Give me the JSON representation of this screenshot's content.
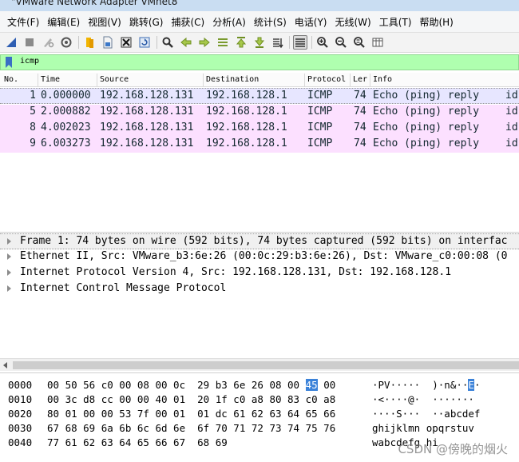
{
  "window": {
    "title": "\"VMware Network Adapter VMnet8"
  },
  "menu": [
    "文件(F)",
    "编辑(E)",
    "视图(V)",
    "跳转(G)",
    "捕获(C)",
    "分析(A)",
    "统计(S)",
    "电话(Y)",
    "无线(W)",
    "工具(T)",
    "帮助(H)"
  ],
  "filter": {
    "value": "icmp"
  },
  "packet_list": {
    "columns": [
      "No.",
      "Time",
      "Source",
      "Destination",
      "Protocol",
      "Ler",
      "Info"
    ],
    "rows": [
      {
        "no": "1",
        "time": "0.000000",
        "source": "192.168.128.131",
        "destination": "192.168.128.1",
        "protocol": "ICMP",
        "length": "74",
        "info": "Echo (ping) reply",
        "extra": "id"
      },
      {
        "no": "5",
        "time": "2.000882",
        "source": "192.168.128.131",
        "destination": "192.168.128.1",
        "protocol": "ICMP",
        "length": "74",
        "info": "Echo (ping) reply",
        "extra": "id"
      },
      {
        "no": "8",
        "time": "4.002023",
        "source": "192.168.128.131",
        "destination": "192.168.128.1",
        "protocol": "ICMP",
        "length": "74",
        "info": "Echo (ping) reply",
        "extra": "id"
      },
      {
        "no": "9",
        "time": "6.003273",
        "source": "192.168.128.131",
        "destination": "192.168.128.1",
        "protocol": "ICMP",
        "length": "74",
        "info": "Echo (ping) reply",
        "extra": "id"
      }
    ]
  },
  "details": [
    "Frame 1: 74 bytes on wire (592 bits), 74 bytes captured (592 bits) on interfac",
    "Ethernet II, Src: VMware_b3:6e:26 (00:0c:29:b3:6e:26), Dst: VMware_c0:00:08 (0",
    "Internet Protocol Version 4, Src: 192.168.128.131, Dst: 192.168.128.1",
    "Internet Control Message Protocol"
  ],
  "bytes": [
    {
      "offset": "0000",
      "hex_a": "00 50 56 c0 00 08 00 0c  29 b3 6e 26 08 00 ",
      "hex_sel": "45",
      "hex_b": " 00",
      "ascii_a": "·PV·····  )·n&··",
      "ascii_sel": "E",
      "ascii_b": "·"
    },
    {
      "offset": "0010",
      "hex_a": "00 3c d8 cc 00 00 40 01  20 1f c0 a8 80 83 c0 a8",
      "hex_sel": "",
      "hex_b": "",
      "ascii_a": "·<····@·  ·······",
      "ascii_sel": "",
      "ascii_b": ""
    },
    {
      "offset": "0020",
      "hex_a": "80 01 00 00 53 7f 00 01  01 dc 61 62 63 64 65 66",
      "hex_sel": "",
      "hex_b": "",
      "ascii_a": "····S···  ··abcdef",
      "ascii_sel": "",
      "ascii_b": ""
    },
    {
      "offset": "0030",
      "hex_a": "67 68 69 6a 6b 6c 6d 6e  6f 70 71 72 73 74 75 76",
      "hex_sel": "",
      "hex_b": "",
      "ascii_a": "ghijklmn opqrstuv",
      "ascii_sel": "",
      "ascii_b": ""
    },
    {
      "offset": "0040",
      "hex_a": "77 61 62 63 64 65 66 67  68 69",
      "hex_sel": "",
      "hex_b": "",
      "ascii_a": "wabcdefg hi",
      "ascii_sel": "",
      "ascii_b": ""
    }
  ],
  "watermark": "CSDN @傍晚的烟火",
  "colors": {
    "filter_bg": "#afffaf",
    "row_selected": "#e7e6ff",
    "row_icmp": "#fce0ff",
    "selection": "#3b82d9"
  },
  "toolbar_icons": [
    "shark-fin-start-icon",
    "stop-icon",
    "restart-icon",
    "options-gear-icon",
    "open-file-icon",
    "save-file-icon",
    "close-file-icon",
    "reload-icon",
    "find-icon",
    "back-arrow-icon",
    "forward-arrow-icon",
    "goto-packet-icon",
    "first-packet-icon",
    "last-packet-icon",
    "autoscroll-icon",
    "colorize-icon",
    "zoom-in-icon",
    "zoom-out-icon",
    "normal-size-icon",
    "resize-columns-icon"
  ]
}
